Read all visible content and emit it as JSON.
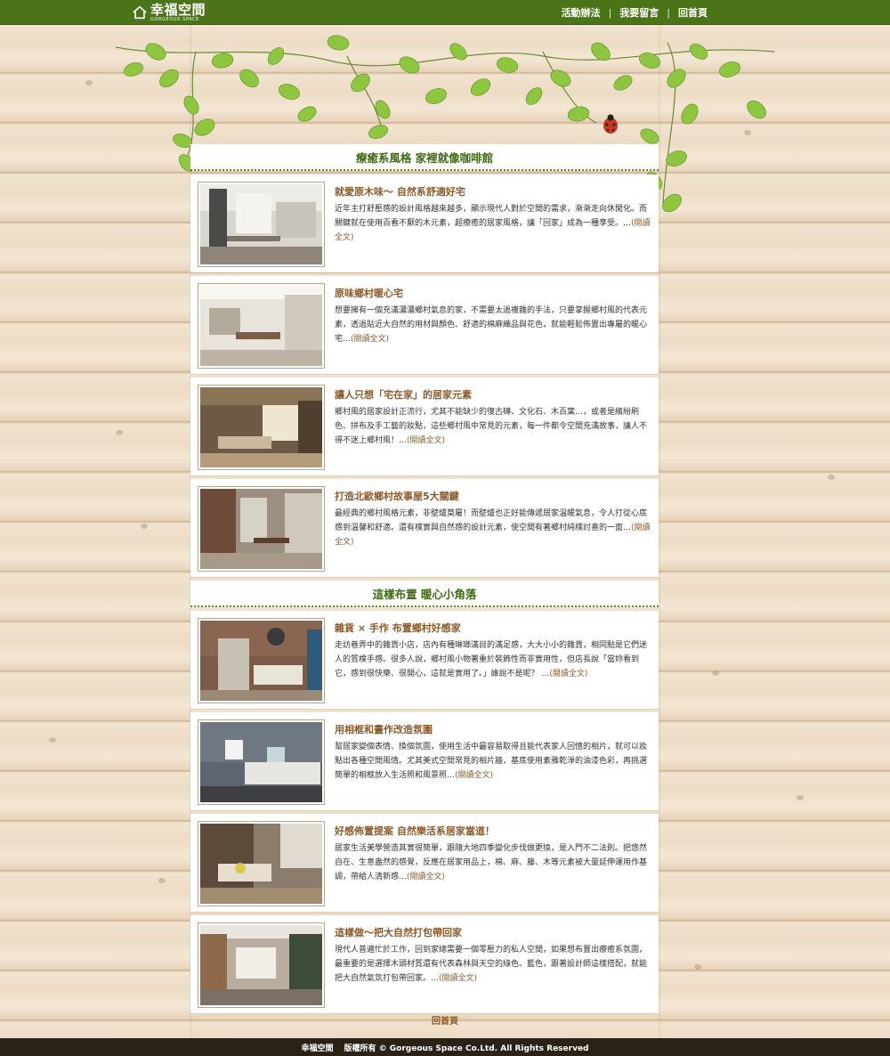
{
  "header": {
    "logo_main": "幸福空間",
    "logo_sub": "GORGEOUS SPACE",
    "nav": [
      "活動辦法",
      "我要留言",
      "回首頁"
    ],
    "nav_separator": "|"
  },
  "sections": [
    {
      "title": "療癒系風格 家裡就像咖啡館",
      "articles": [
        {
          "title": "就愛原木味～ 自然系舒適好宅",
          "text": "近年主打舒壓感的設計風格越來越多，顯示現代人對於空間的需求，漸漸走向休閒化。而關鍵就在使用百看不厭的木元素，超療癒的居家風格，讓「回家」成為一種享受。…",
          "more": "(閱讀全文)"
        },
        {
          "title": "原味鄉村暖心宅",
          "text": "想要擁有一個充滿濃濃鄉村氣息的家，不需要太過複雜的手法，只要掌握鄉村風的代表元素，透過貼近大自然的用材與顏色、舒適的棉麻織品與花色，就能輕鬆佈置出專屬的暖心宅…",
          "more": "(閱讀全文)"
        },
        {
          "title": "讓人只想「宅在家」的居家元素",
          "text": "鄉村風的居家設計正流行，尤其不能缺少的復古磚、文化石、木百葉…，或者是繽紛刷色、拼布及手工藝的妝點，這些鄉村風中常見的元素，每一件都令空間充滿故事，讓人不得不迷上鄉村風！…",
          "more": "(閱讀全文)"
        },
        {
          "title": "打造北歐鄉村故事屋5大關鍵",
          "text": "最經典的鄉村風格元素，非壁爐莫屬！而壁爐也正好能傳遞居家溫暖氣息，令人打從心底感到溫馨和舒適。還有樸實與自然感的設計元素，使空間有著鄉村純樸討喜的一面…",
          "more": "(閱讀全文)"
        }
      ]
    },
    {
      "title": "這樣布置 暖心小角落",
      "articles": [
        {
          "title": "雜貨 × 手作 布置鄉村好感家",
          "text": "走訪巷弄中的雜貨小店，店內有種琳瑯滿目的滿足感，大大小小的雜貨，相同點是它們迷人的質樸手感。很多人說，鄉村風小物著重於裝飾性而非實用性，但店長說「當妳看到它，感到很快樂、很開心，這就是實用了。」誰說不是呢？ …",
          "more": "(閱讀全文)"
        },
        {
          "title": "用相框和畫作改造氛圍",
          "text": "幫居家變個表情、換個氛圍，使用生活中最容易取得且能代表家人回憶的相片，就可以妝點出各種空間風情。尤其美式空間常見的相片牆，基底使用素雅乾淨的油漆色彩，再挑選簡單的相框放入生活照和風景照…",
          "more": "(閱讀全文)"
        },
        {
          "title": "好感佈置提案 自然樂活系居家當道！",
          "text": "居家生活美學營造其實很簡單，跟隨大地四季變化步伐做更換，是入門不二法則。把悠然自在、生意盎然的感覺，反應在居家用品上，棉、麻、藤、木等元素被大量延伸運用作基調，帶給人清新感…",
          "more": "(閱讀全文)"
        },
        {
          "title": "這樣做～把大自然打包帶回家",
          "text": "現代人普遍忙於工作，回到家總需要一個零壓力的私人空間，如果想布置出療癒系氛圍，最重要的是選擇木頭材質還有代表森林與天空的綠色、藍色，跟著設計師這樣搭配，就能把大自然氣氛打包帶回家。…",
          "more": "(閱讀全文)"
        }
      ]
    }
  ],
  "home_link": "回首頁",
  "footer": {
    "brand": "幸福空間",
    "rights": "版權所有 © Gorgeous Space Co.Ltd. All Rights Reserved"
  },
  "colors": {
    "header_green": "#4a7417",
    "title_green": "#3f6a14",
    "link_brown": "#8b5a2b",
    "footer_dark": "#2a2217"
  }
}
